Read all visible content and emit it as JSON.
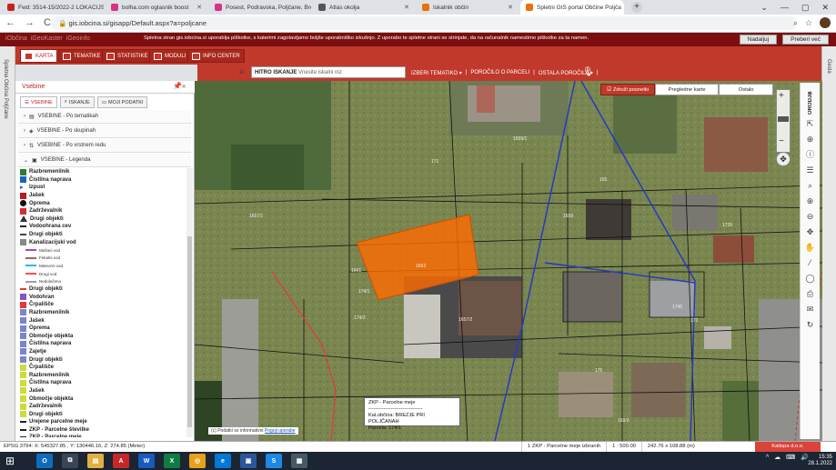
{
  "browser": {
    "tabs": [
      {
        "title": "Fwd: 3514-15/2022-2 LOKACIJSK",
        "color": "#c5221f",
        "active": false
      },
      {
        "title": "bolha.com oglasnik boost",
        "color": "#d63384",
        "active": false
      },
      {
        "title": "Posest, Podravska, Poljčane, Bre:",
        "color": "#d63384",
        "active": false
      },
      {
        "title": "Atlas okolja",
        "color": "#555555",
        "active": false
      },
      {
        "title": "Iskalnik občin",
        "color": "#e8710a",
        "active": false
      },
      {
        "title": "Spletni GIS portal Občine Poljča",
        "color": "#e8710a",
        "active": true
      }
    ],
    "new_tab": "+",
    "window_controls": [
      "⌄",
      "—",
      "▢",
      "✕"
    ],
    "url": "gis.iobcina.si/gisapp/Default.aspx?a=poljcane",
    "nav": [
      "←",
      "→",
      "C"
    ],
    "omni_icons": [
      "⌕",
      "☆"
    ]
  },
  "site": {
    "brand_links": [
      "iObčina",
      "iGeoKaster",
      "iGeoinfo"
    ],
    "cookie_notice": "Spletna stran gis.iobcina.si uporablja piškotke, s katerimi zagotavljamo boljše uporabniško izkušnjo. Z uporabo te spletne strani se strinjate, da na računalnik namestimo piškotke za ta namen.",
    "cookie_buttons": [
      "Nadaljuj",
      "Preberi več"
    ],
    "left_strip": "Spletna Občina Poljčane",
    "right_strip": "Gesla"
  },
  "toolbar": {
    "tabs": [
      "KARTA",
      "TEMATIKE",
      "STATISTIKE",
      "MODULI",
      "INFO CENTER"
    ],
    "search_value": "HITRO ISKANJE",
    "search_placeholder": "Vnesite iskalni niz",
    "menu": [
      "IZBERI TEMATIKO ▾",
      "|",
      "POROČILO O PARCELI",
      "|",
      "OSTALA POROČILA ▾",
      "|"
    ]
  },
  "panel": {
    "title": "Vsebine",
    "tabs": [
      "VSEBINE",
      "ISKANJE",
      "MOJI PODATKI"
    ],
    "groups": [
      "VSEBINE - Po tematikah",
      "VSEBINE - Po skupinah",
      "VSEBINE - Po vrstnem redu",
      "VSEBINE - Legenda"
    ],
    "legend": [
      {
        "label": "Razbremenilnik",
        "color": "#2e7d32",
        "kind": "box",
        "sub": false
      },
      {
        "label": "Čistilna naprava",
        "color": "#1565c0",
        "kind": "box",
        "sub": false
      },
      {
        "label": "Izpust",
        "color": "#3b5bdb",
        "kind": "arrow",
        "sub": false
      },
      {
        "label": "Jašek",
        "color": "#b71c1c",
        "kind": "box",
        "sub": false
      },
      {
        "label": "Oprema",
        "color": "#111111",
        "kind": "dot",
        "sub": false
      },
      {
        "label": "Zadrževalnik",
        "color": "#d32f2f",
        "kind": "box",
        "sub": false
      },
      {
        "label": "Drugi objekti",
        "color": "#333333",
        "kind": "tri",
        "sub": false
      },
      {
        "label": "Vodoohrana cev",
        "color": "#222222",
        "kind": "line",
        "sub": false
      },
      {
        "label": "Drugi objekti",
        "color": "#444444",
        "kind": "line",
        "sub": false
      },
      {
        "label": "Kanalizacijski vod",
        "color": "#888888",
        "kind": "box",
        "sub": false
      },
      {
        "label": "Mešani vod",
        "color": "#ab47bc",
        "kind": "line",
        "sub": true
      },
      {
        "label": "Fekalni vod",
        "color": "#8d6e63",
        "kind": "line",
        "sub": true
      },
      {
        "label": "Meteorni vod",
        "color": "#29b6f6",
        "kind": "line",
        "sub": true
      },
      {
        "label": "Drugi vod",
        "color": "#ef5350",
        "kind": "line",
        "sub": true
      },
      {
        "label": "Nedoločeno",
        "color": "#9e9e9e",
        "kind": "line",
        "sub": true
      },
      {
        "label": "Drugi objekti",
        "color": "#e53935",
        "kind": "line",
        "sub": false
      },
      {
        "label": "Vodohran",
        "color": "#7e57c2",
        "kind": "box",
        "sub": false
      },
      {
        "label": "Črpališče",
        "color": "#e53935",
        "kind": "box",
        "sub": false
      },
      {
        "label": "Razbremenilnik",
        "color": "#7986cb",
        "kind": "box",
        "sub": false
      },
      {
        "label": "Jašek",
        "color": "#7986cb",
        "kind": "box",
        "sub": false
      },
      {
        "label": "Oprema",
        "color": "#7986cb",
        "kind": "box",
        "sub": false
      },
      {
        "label": "Območje objekta",
        "color": "#7986cb",
        "kind": "box",
        "sub": false
      },
      {
        "label": "Čistilna naprava",
        "color": "#7986cb",
        "kind": "box",
        "sub": false
      },
      {
        "label": "Zajetje",
        "color": "#7986cb",
        "kind": "box",
        "sub": false
      },
      {
        "label": "Drugi objekti",
        "color": "#7986cb",
        "kind": "box",
        "sub": false
      },
      {
        "label": "Črpališče",
        "color": "#cddc39",
        "kind": "box",
        "sub": false
      },
      {
        "label": "Razbremenilnik",
        "color": "#cddc39",
        "kind": "box",
        "sub": false
      },
      {
        "label": "Čistilna naprava",
        "color": "#cddc39",
        "kind": "box",
        "sub": false
      },
      {
        "label": "Jašek",
        "color": "#cddc39",
        "kind": "box",
        "sub": false
      },
      {
        "label": "Območje objekta",
        "color": "#cddc39",
        "kind": "box",
        "sub": false
      },
      {
        "label": "Zadrževalnik",
        "color": "#cddc39",
        "kind": "box",
        "sub": false
      },
      {
        "label": "Drugi objekti",
        "color": "#cddc39",
        "kind": "box",
        "sub": false
      },
      {
        "label": "Urejene parcelne meje",
        "color": "#222222",
        "kind": "line",
        "sub": false
      },
      {
        "label": "ZKP - Parcelne številke",
        "color": "#222222",
        "kind": "line",
        "sub": false
      },
      {
        "label": "ZKP - Parcelne meje",
        "color": "#222222",
        "kind": "line",
        "sub": false
      }
    ]
  },
  "map": {
    "overlay_buttons": [
      "Združi posnetki",
      "Pregledne karte",
      "Ostalo"
    ],
    "tools_label": "ORODJA",
    "tool_icons": [
      "»",
      "⇱",
      "⊕",
      "ⓘ",
      "☰",
      "⌕",
      "⊕",
      "⊖",
      "✥",
      "✋",
      "⁄",
      "◯",
      "⎙",
      "✉",
      "↻"
    ],
    "parcel_labels": [
      "1657/1",
      "1662",
      "1661",
      "174/1",
      "174/3",
      "1657/2",
      "1659",
      "1659/1",
      "171",
      "1745",
      "165",
      "1735",
      "172",
      "175",
      "169/3"
    ],
    "popup": {
      "title": "ZKP - Parcelne meje",
      "sep": "--------------------------------",
      "line1": "Kat.občina: BREZJE PRI POLJČANAH",
      "line2": "Parcela: 174/1"
    },
    "attribution": "(c) Podatki so informativni",
    "attribution_link": "Pogoji uporabe"
  },
  "status": {
    "coords": "EPSG 3794: X: 545327.85 , Y: 130446.16, Z: 274.85 (Meter)",
    "selected": "1 ZKP - Parcelne meje izbranih",
    "scale": "1 : 500.00",
    "size": "242.76 x 108.88 (m)",
    "brand": "Kaliopa d.o.o."
  },
  "taskbar": {
    "apps": [
      {
        "label": "O",
        "color": "#0f6cbd"
      },
      {
        "label": "⧉",
        "color": "#3a4556"
      },
      {
        "label": "▤",
        "color": "#e0b040"
      },
      {
        "label": "A",
        "color": "#c62828"
      },
      {
        "label": "W",
        "color": "#185abd"
      },
      {
        "label": "X",
        "color": "#107c41"
      },
      {
        "label": "◎",
        "color": "#e8a11a"
      },
      {
        "label": "e",
        "color": "#0078d4"
      },
      {
        "label": "▣",
        "color": "#2b579a"
      },
      {
        "label": "S",
        "color": "#1e88e5"
      },
      {
        "label": "▦",
        "color": "#455a64"
      }
    ],
    "tray": [
      "^",
      "☁",
      "⌨",
      "🔊"
    ],
    "time": "15:35",
    "date": "28.1.2022"
  }
}
